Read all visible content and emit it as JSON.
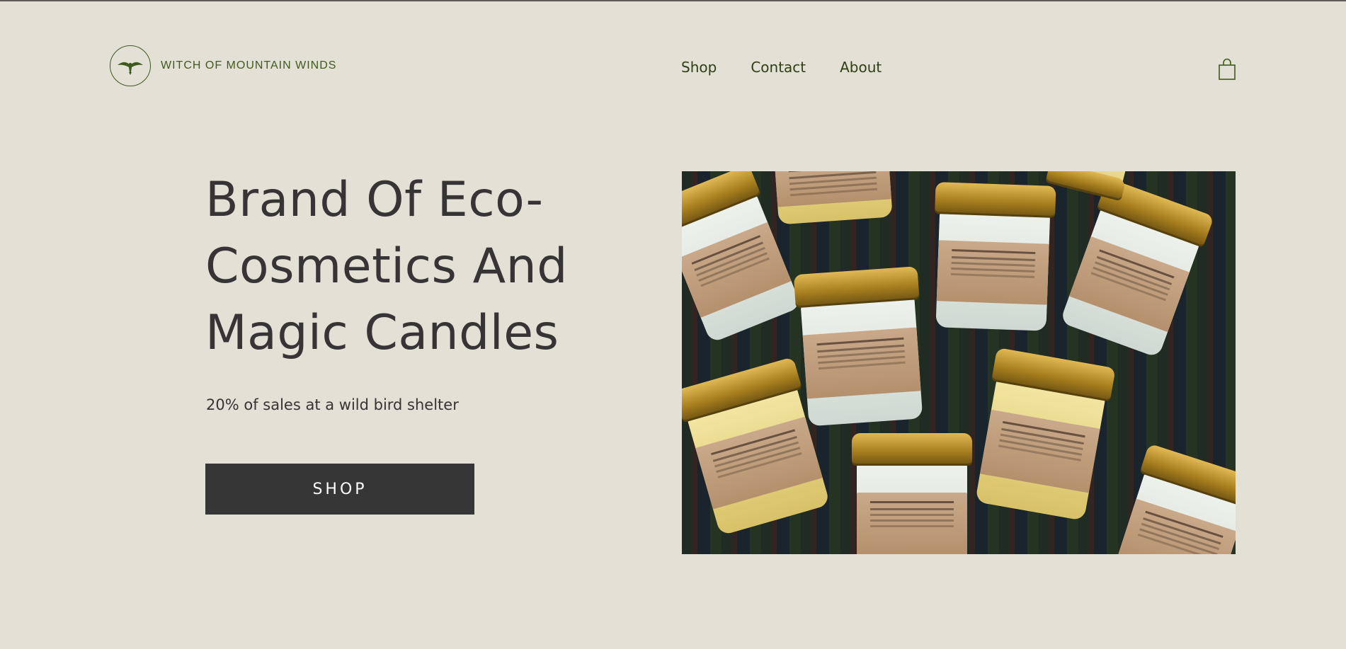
{
  "brand": {
    "name": "WITCH OF MOUNTAIN WINDS",
    "logo_icon": "bird-icon",
    "color": "#3f5a1e"
  },
  "nav": {
    "items": [
      {
        "label": "Shop"
      },
      {
        "label": "Contact"
      },
      {
        "label": "About"
      }
    ]
  },
  "header": {
    "cart_icon": "shopping-bag-icon"
  },
  "hero": {
    "title": "Brand Of Eco-Cosmetics And Magic Candles",
    "subtitle": "20% of sales at a wild bird shelter",
    "cta_label": "SHOP",
    "image_description": "jars of eco cosmetics cream on a patterned fabric"
  },
  "colors": {
    "background": "#e3e0d5",
    "text": "#363434",
    "button": "#363636",
    "button_text": "#ffffff"
  }
}
